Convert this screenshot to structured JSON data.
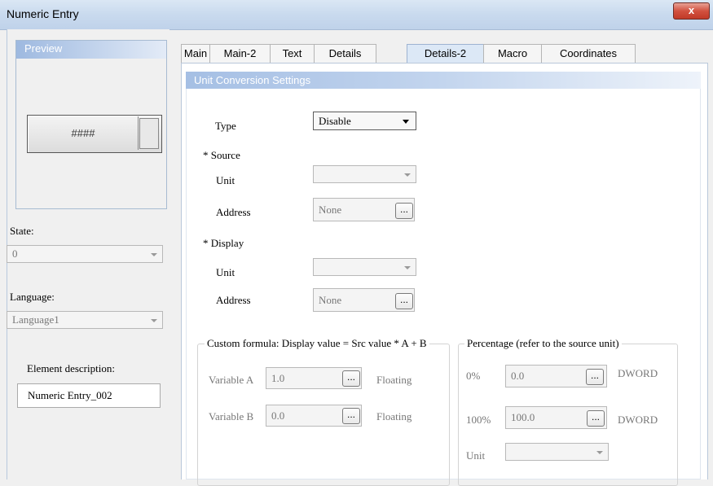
{
  "window": {
    "title": "Numeric Entry",
    "close_glyph": "x"
  },
  "preview": {
    "header": "Preview",
    "value": "####"
  },
  "state": {
    "label": "State:",
    "value": "0"
  },
  "language": {
    "label": "Language:",
    "value": "Language1"
  },
  "element_description": {
    "label": "Element description:",
    "value": "Numeric Entry_002"
  },
  "tabs": [
    {
      "label": "Main"
    },
    {
      "label": "Main-2"
    },
    {
      "label": "Text"
    },
    {
      "label": "Details"
    },
    {
      "label": "Details-2"
    },
    {
      "label": "Macro"
    },
    {
      "label": "Coordinates"
    }
  ],
  "active_tab": "Details-2",
  "section": {
    "title": "Unit Conversion Settings",
    "type_label": "Type",
    "type_value": "Disable",
    "source": {
      "heading": "* Source",
      "unit_label": "Unit",
      "unit_value": "",
      "address_label": "Address",
      "address_value": "None"
    },
    "display": {
      "heading": "* Display",
      "unit_label": "Unit",
      "unit_value": "",
      "address_label": "Address",
      "address_value": "None"
    },
    "custom_formula": {
      "title": "Custom formula: Display value = Src value * A + B",
      "var_a_label": "Variable A",
      "var_a_value": "1.0",
      "var_a_type": "Floating",
      "var_b_label": "Variable B",
      "var_b_value": "0.0",
      "var_b_type": "Floating"
    },
    "percentage": {
      "title": "Percentage (refer to the source unit)",
      "p0_label": "0%",
      "p0_value": "0.0",
      "p0_type": "DWORD",
      "p100_label": "100%",
      "p100_value": "100.0",
      "p100_type": "DWORD",
      "unit_label": "Unit",
      "unit_value": ""
    },
    "browse_glyph": "..."
  }
}
